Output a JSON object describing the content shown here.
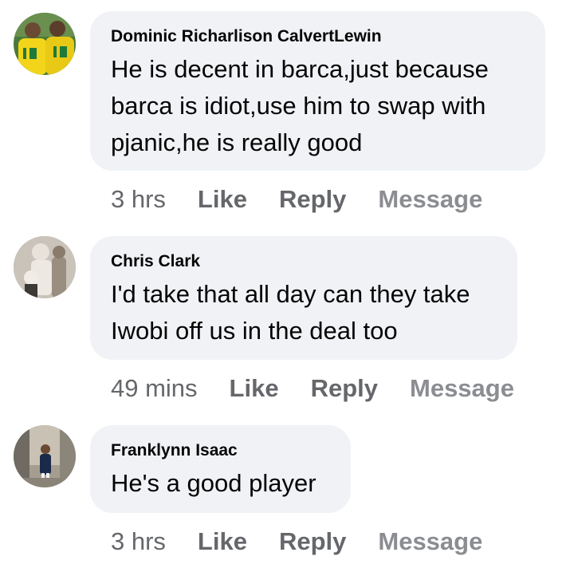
{
  "comments": [
    {
      "author": "Dominic Richarlison CalvertLewin",
      "text": "He is decent in barca,just because barca is idiot,use him to swap with pjanic,he is really good",
      "time": "3 hrs",
      "like_label": "Like",
      "reply_label": "Reply",
      "message_label": "Message"
    },
    {
      "author": "Chris Clark",
      "text": "I'd take that all day can they take Iwobi off us in the deal too",
      "time": "49 mins",
      "like_label": "Like",
      "reply_label": "Reply",
      "message_label": "Message"
    },
    {
      "author": "Franklynn Isaac",
      "text": "He's a good player",
      "time": "3 hrs",
      "like_label": "Like",
      "reply_label": "Reply",
      "message_label": "Message"
    }
  ]
}
